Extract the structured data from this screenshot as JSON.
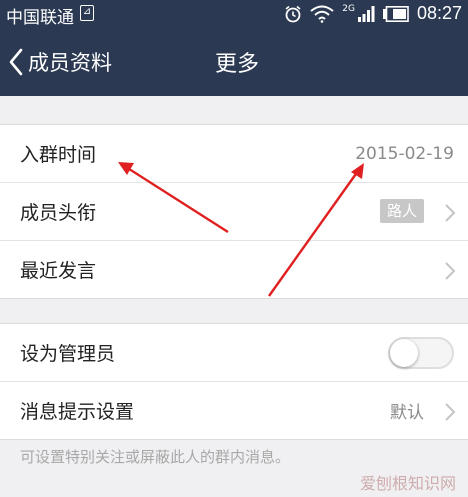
{
  "status_bar": {
    "carrier": "中国联通",
    "network": "2G",
    "time": "08:27"
  },
  "nav": {
    "back_label": "成员资料",
    "title": "更多"
  },
  "group1": [
    {
      "label": "入群时间",
      "value": "2015-02-19"
    },
    {
      "label": "成员头衔",
      "tag": "路人"
    },
    {
      "label": "最近发言"
    }
  ],
  "group2": [
    {
      "label": "设为管理员",
      "toggle_on": false
    },
    {
      "label": "消息提示设置",
      "value": "默认"
    }
  ],
  "hint": "可设置特别关注或屏蔽此人的群内消息。",
  "watermark": "爱刨根知识网",
  "colors": {
    "header_bg": "#2b3a52",
    "annotation_arrow": "#e02020",
    "page_bg": "#f0f0f2"
  }
}
